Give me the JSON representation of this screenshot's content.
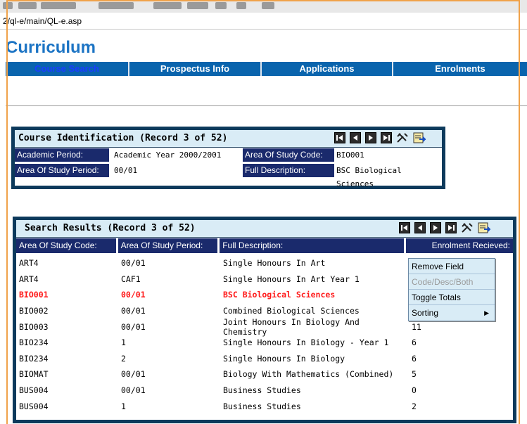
{
  "browser": {
    "address": "2/ql-e/main/QL-e.asp"
  },
  "app": {
    "title": "Curriculum"
  },
  "nav": {
    "items": [
      {
        "label": "Course Search",
        "active": true
      },
      {
        "label": "Prospectus Info",
        "active": false
      },
      {
        "label": "Applications",
        "active": false
      },
      {
        "label": "Enrolments",
        "active": false
      }
    ]
  },
  "course_identification": {
    "title": "Course Identification (Record 3 of 52)",
    "fields": {
      "academic_period_label": "Academic Period:",
      "academic_period_value": "Academic Year 2000/2001",
      "area_code_label": "Area Of Study Code:",
      "area_code_value": "BIO001",
      "area_period_label": "Area Of Study Period:",
      "area_period_value": "00/01",
      "full_desc_label": "Full Description:",
      "full_desc_value": "BSC Biological Sciences"
    }
  },
  "search_results": {
    "title": "Search Results (Record 3 of 52)",
    "columns": [
      "Area Of Study Code:",
      "Area Of Study Period:",
      "Full Description:",
      "Enrolment Recieved:"
    ],
    "rows": [
      {
        "code": "ART4",
        "period": "00/01",
        "description": "Single Honours In Art",
        "enrolment": "",
        "selected": false
      },
      {
        "code": "ART4",
        "period": "CAF1",
        "description": "Single Honours In Art Year 1",
        "enrolment": "",
        "selected": false
      },
      {
        "code": "BIO001",
        "period": "00/01",
        "description": "BSC Biological Sciences",
        "enrolment": "",
        "selected": true
      },
      {
        "code": "BIO002",
        "period": "00/01",
        "description": "Combined Biological Sciences",
        "enrolment": "",
        "selected": false
      },
      {
        "code": "BIO003",
        "period": "00/01",
        "description": "Joint Honours In Biology And Chemistry",
        "enrolment": "11",
        "selected": false
      },
      {
        "code": "BIO234",
        "period": "1",
        "description": "Single Honours In Biology - Year 1",
        "enrolment": "6",
        "selected": false
      },
      {
        "code": "BIO234",
        "period": "2",
        "description": "Single Honours In Biology",
        "enrolment": "6",
        "selected": false
      },
      {
        "code": "BIOMAT",
        "period": "00/01",
        "description": "Biology With Mathematics (Combined)",
        "enrolment": "5",
        "selected": false
      },
      {
        "code": "BUS004",
        "period": "00/01",
        "description": "Business Studies",
        "enrolment": "0",
        "selected": false
      },
      {
        "code": "BUS004",
        "period": "1",
        "description": "Business Studies",
        "enrolment": "2",
        "selected": false
      }
    ]
  },
  "context_menu": {
    "items": [
      {
        "label": "Remove Field",
        "disabled": false
      },
      {
        "label": "Code/Desc/Both",
        "disabled": true
      },
      {
        "label": "Toggle Totals",
        "disabled": false
      },
      {
        "label": "Sorting",
        "disabled": false,
        "submenu": true
      }
    ]
  },
  "icons": {
    "nav_buttons": [
      "first-record-icon",
      "previous-record-icon",
      "next-record-icon",
      "last-record-icon"
    ],
    "tools": [
      "tools-icon",
      "export-icon"
    ]
  },
  "colors": {
    "nav_bar": "#0a64ad",
    "panel_border": "#0d3a5c",
    "label_bg": "#1a2a6c",
    "header_bg": "#d9ecf6",
    "selected_row": "#ff1a1a",
    "title": "#1c74c4"
  }
}
